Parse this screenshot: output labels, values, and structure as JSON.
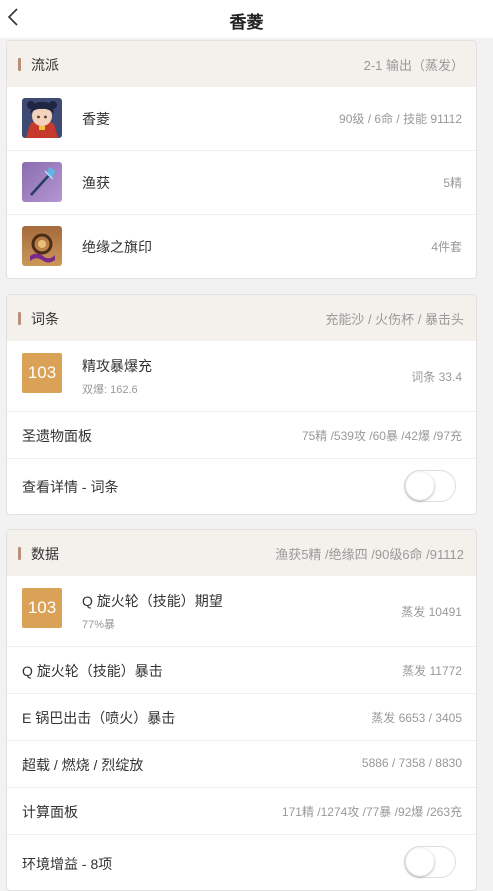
{
  "header": {
    "title": "香菱"
  },
  "cards": {
    "school": {
      "title": "流派",
      "summary": "2-1 输出（蒸发）",
      "items": [
        {
          "name": "香菱",
          "value": "90级 / 6命 / 技能 91112",
          "icon": "character-portrait"
        },
        {
          "name": "渔获",
          "value": "5精",
          "icon": "polearm-weapon"
        },
        {
          "name": "绝缘之旗印",
          "value": "4件套",
          "icon": "artifact-set"
        }
      ]
    },
    "stats": {
      "title": "词条",
      "summary": "充能沙 / 火伤杯 / 暴击头",
      "score": "103",
      "main_label": "精攻暴爆充",
      "sub_label": "双爆: 162.6",
      "main_value": "词条 33.4",
      "panel_label": "圣遗物面板",
      "panel_value": "75精 /539攻 /60暴 /42爆 /97充",
      "detail_label": "查看详情 - 词条",
      "detail_toggle": false
    },
    "data": {
      "title": "数据",
      "summary": "渔获5精 /绝缘四 /90级6命 /91112",
      "score": "103",
      "main_label": "Q 旋火轮（技能）期望",
      "sub_label": "77%暴",
      "main_value": "蒸发 10491",
      "rows": [
        {
          "label": "Q 旋火轮（技能）暴击",
          "value": "蒸发 11772"
        },
        {
          "label": "E 锅巴出击（喷火）暴击",
          "value": "蒸发 6653 / 3405"
        },
        {
          "label": "超载 / 燃烧 / 烈绽放",
          "value": "5886 / 7358 / 8830"
        },
        {
          "label": "计算面板",
          "value": "171精 /1274攻 /77暴 /92爆 /263充"
        }
      ],
      "env_label": "环境增益 - 8项",
      "env_toggle": false
    }
  },
  "colors": {
    "accent_bar": "#b88f78",
    "badge": "#d9a256",
    "header_bg": "#f4f1ec"
  }
}
